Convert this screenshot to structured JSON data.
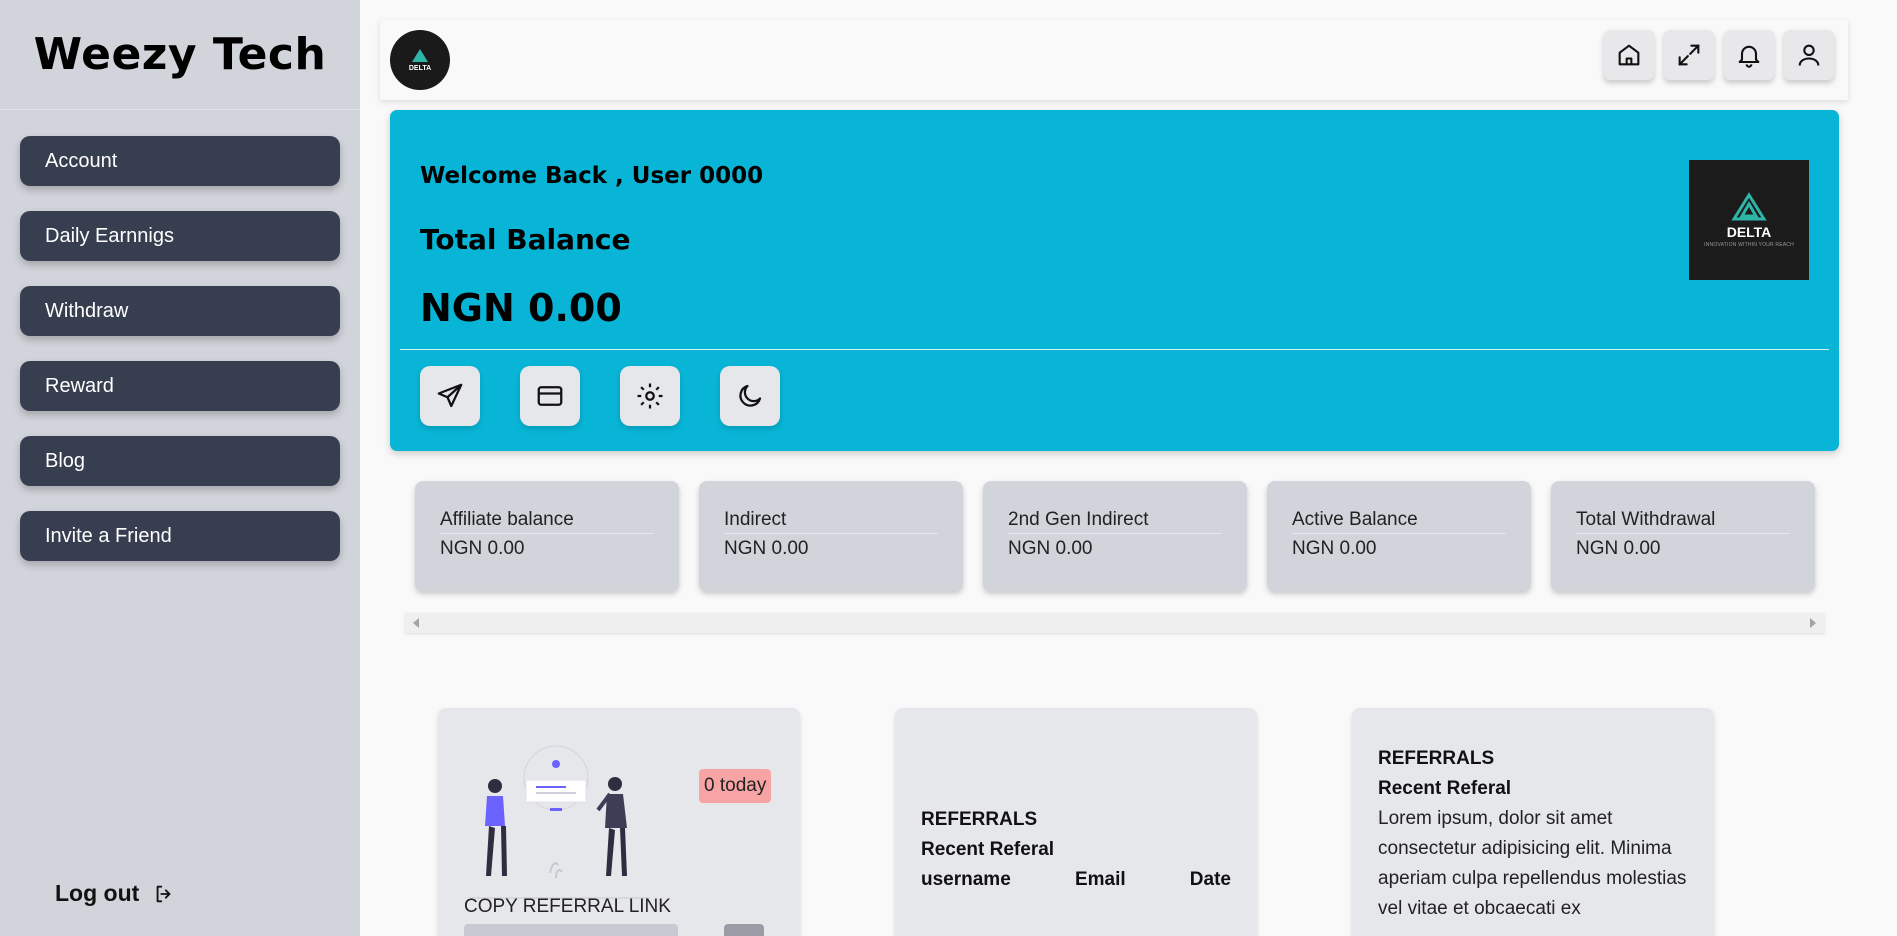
{
  "sidebar": {
    "brand": "Weezy Tech",
    "items": [
      {
        "label": "Account"
      },
      {
        "label": "Daily Earnnigs"
      },
      {
        "label": "Withdraw"
      },
      {
        "label": "Reward"
      },
      {
        "label": "Blog"
      },
      {
        "label": "Invite a Friend"
      }
    ],
    "logout_label": "Log out"
  },
  "topbar": {
    "avatar_text": "DELTA",
    "icons": [
      "home-icon",
      "expand-icon",
      "bell-icon",
      "user-icon"
    ]
  },
  "hero": {
    "welcome": "Welcome Back , User 0000",
    "total_label": "Total Balance",
    "total_amount": "NGN 0.00",
    "logo_name": "DELTA",
    "logo_tagline": "INNOVATION WITHIN YOUR REACH",
    "actions": [
      "send-icon",
      "card-icon",
      "settings-icon",
      "moon-icon"
    ],
    "background_color": "#08b5d6"
  },
  "stats": [
    {
      "label": "Affiliate balance",
      "value": "NGN 0.00"
    },
    {
      "label": "Indirect",
      "value": "NGN 0.00"
    },
    {
      "label": "2nd Gen Indirect",
      "value": "NGN 0.00"
    },
    {
      "label": "Active Balance",
      "value": "NGN 0.00"
    },
    {
      "label": "Total Withdrawal",
      "value": "NGN 0.00"
    }
  ],
  "referral_card": {
    "today_badge": "0 today",
    "copy_label": "COPY REFERRAL LINK"
  },
  "referrals_table": {
    "title": "REFERRALS",
    "subtitle": "Recent Referal",
    "columns": [
      "username",
      "Email",
      "Date"
    ]
  },
  "referrals_text": {
    "title": "REFERRALS",
    "subtitle": "Recent Referal",
    "body": "Lorem ipsum, dolor sit amet consectetur adipisicing elit. Minima aperiam culpa repellendus molestias vel vitae et obcaecati ex"
  }
}
